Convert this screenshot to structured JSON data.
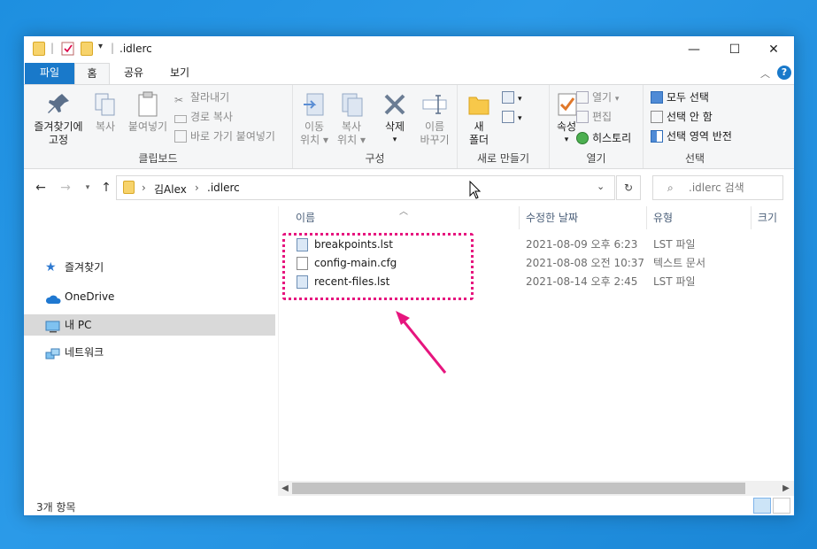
{
  "window": {
    "title": ".idlerc",
    "minimize": "—",
    "maximize": "☐",
    "close": "✕"
  },
  "tabs": {
    "file": "파일",
    "home": "홈",
    "share": "공유",
    "view": "보기"
  },
  "ribbon": {
    "clipboard": {
      "label": "클립보드",
      "pin_line1": "즐겨찾기에",
      "pin_line2": "고정",
      "copy": "복사",
      "paste": "붙여넣기",
      "cut": "잘라내기",
      "copy_path": "경로 복사",
      "paste_shortcut": "바로 가기 붙여넣기"
    },
    "organize": {
      "label": "구성",
      "move_line1": "이동",
      "move_line2": "위치",
      "copyto_line1": "복사",
      "copyto_line2": "위치",
      "delete": "삭제",
      "rename_line1": "이름",
      "rename_line2": "바꾸기"
    },
    "new": {
      "label": "새로 만들기",
      "newfolder_line1": "새",
      "newfolder_line2": "폴더"
    },
    "open": {
      "label": "열기",
      "properties": "속성",
      "open": "열기",
      "edit": "편집",
      "history": "히스토리"
    },
    "select": {
      "label": "선택",
      "select_all": "모두 선택",
      "select_none": "선택 안 함",
      "invert": "선택 영역 반전"
    }
  },
  "address": {
    "crumb_user": "김Alex",
    "crumb_folder": ".idlerc",
    "search_placeholder": ".idlerc 검색"
  },
  "nav_pane": {
    "items": [
      {
        "label": "즐겨찾기"
      },
      {
        "label": "OneDrive"
      },
      {
        "label": "내 PC"
      },
      {
        "label": "네트워크"
      }
    ]
  },
  "columns": {
    "name": "이름",
    "modified": "수정한 날짜",
    "type": "유형",
    "size": "크기"
  },
  "files": [
    {
      "name": "breakpoints.lst",
      "modified": "2021-08-09 오후 6:23",
      "type": "LST 파일"
    },
    {
      "name": "config-main.cfg",
      "modified": "2021-08-08 오전 10:37",
      "type": "텍스트 문서"
    },
    {
      "name": "recent-files.lst",
      "modified": "2021-08-14 오후 2:45",
      "type": "LST 파일"
    }
  ],
  "status": {
    "item_count": "3개 항목"
  },
  "colors": {
    "accent": "#1979ca",
    "highlight": "#e6157e",
    "desktop": "#1e8fe0"
  }
}
